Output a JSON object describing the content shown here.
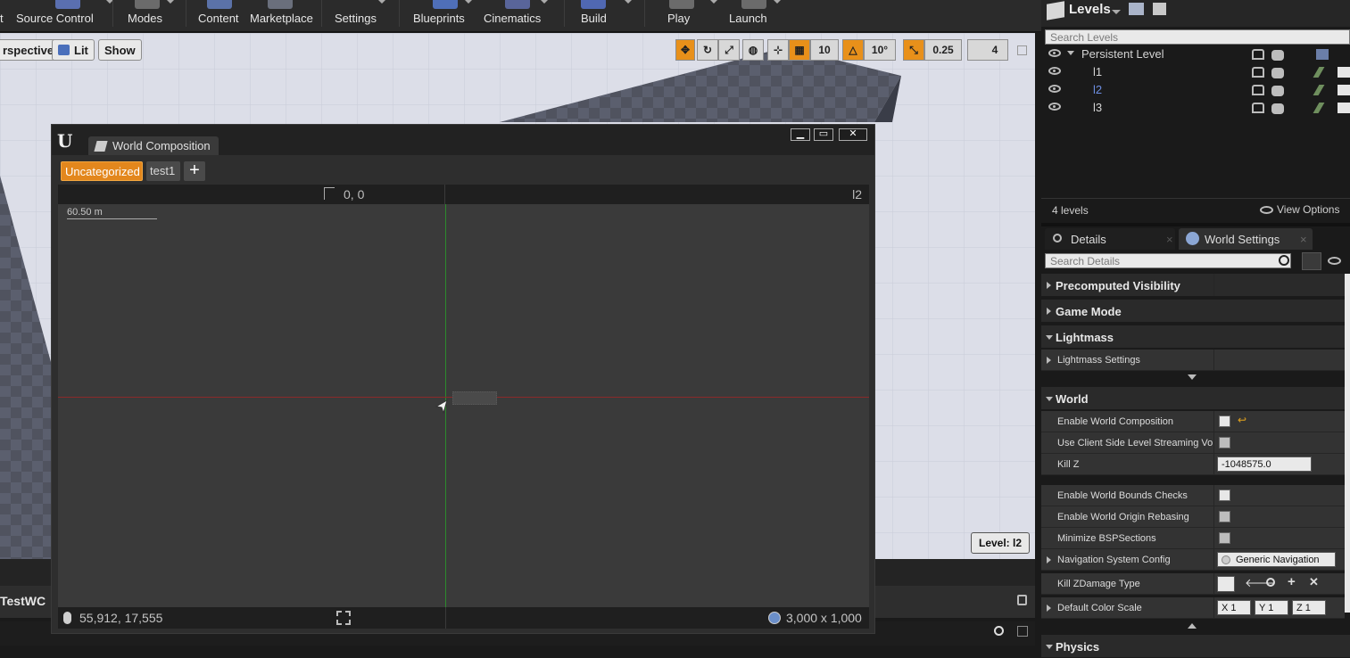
{
  "toolbar": {
    "items": [
      "t",
      "Source Control",
      "Modes",
      "Content",
      "Marketplace",
      "Settings",
      "Blueprints",
      "Cinematics",
      "Build",
      "Play",
      "Launch"
    ]
  },
  "viewport": {
    "perspective_label": "rspective",
    "lit_label": "Lit",
    "show_label": "Show",
    "grid_snap": "10",
    "rotation_snap": "10°",
    "scale_snap": "0.25",
    "camera_speed": "4",
    "level_badge": "Level:  l2"
  },
  "world_composition": {
    "tab_title": "World Composition",
    "categories": [
      "Uncategorized",
      "test1"
    ],
    "add_label": "+",
    "origin_coords": "0, 0",
    "current_level": "l2",
    "scale_label": "60.50 m",
    "mouse_coords": "55,912, 17,555",
    "world_size": "3,000 x 1,000"
  },
  "behind_window": {
    "label": "TestWC"
  },
  "levels": {
    "title": "Levels",
    "search_placeholder": "Search Levels",
    "rows": [
      {
        "name": "Persistent Level"
      },
      {
        "name": "l1"
      },
      {
        "name": "l2"
      },
      {
        "name": "l3"
      }
    ],
    "count_label": "4 levels",
    "view_options": "View Options"
  },
  "details": {
    "tab_details": "Details",
    "tab_world_settings": "World Settings",
    "search_placeholder": "Search Details",
    "sections": {
      "precomputed": "Precomputed Visibility",
      "game_mode": "Game Mode",
      "lightmass": "Lightmass",
      "lightmass_settings": "Lightmass Settings",
      "world": "World"
    },
    "props": {
      "enable_world_composition": "Enable World Composition",
      "client_side": "Use Client Side Level Streaming Vo",
      "kill_z": "Kill Z",
      "kill_z_value": "-1048575.0",
      "bounds_checks": "Enable World Bounds Checks",
      "origin_rebasing": "Enable World Origin Rebasing",
      "minimize_bsp": "Minimize BSPSections",
      "nav_config": "Navigation System Config",
      "nav_value": "Generic Navigation",
      "kill_zdamage": "Kill ZDamage Type",
      "default_color_scale": "Default Color Scale",
      "x_label": "X",
      "y_label": "Y",
      "z_label": "Z",
      "xyz_value": "1",
      "physics": "Physics"
    },
    "checks": {
      "enable_world_composition": true,
      "client_side": false,
      "bounds_checks": true,
      "origin_rebasing": false,
      "minimize_bsp": false
    }
  }
}
